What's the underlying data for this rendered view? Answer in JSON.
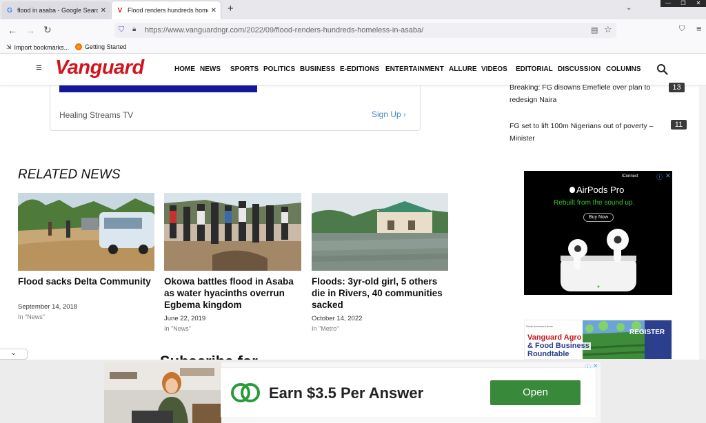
{
  "browser": {
    "tabs": [
      {
        "title": "flood in asaba - Google Search",
        "favicon": "G"
      },
      {
        "title": "Flood renders hundreds homeless in Asaba",
        "favicon": "V"
      }
    ],
    "url": "https://www.vanguardngr.com/2022/09/flood-renders-hundreds-homeless-in-asaba/",
    "bookmarks": [
      "Import bookmarks...",
      "Getting Started"
    ]
  },
  "site": {
    "logo": "Vanguard",
    "menu": [
      "HOME",
      "NEWS",
      "SPORTS",
      "POLITICS",
      "BUSINESS",
      "E-EDITIONS",
      "ENTERTAINMENT",
      "ALLURE",
      "VIDEOS",
      "EDITORIAL",
      "DISCUSSION",
      "COLUMNS"
    ]
  },
  "sponsor_card": {
    "name": "Healing Streams TV",
    "cta": "Sign Up"
  },
  "trending": [
    {
      "text": "Breaking: FG disowns Emefiele over plan to redesign Naira",
      "rank": "13"
    },
    {
      "text": "FG set to lift 100m Nigerians out of poverty – Minister",
      "rank": "11"
    }
  ],
  "related": {
    "heading": "RELATED NEWS",
    "items": [
      {
        "title": "Flood sacks Delta Community",
        "date": "September 14, 2018",
        "category": "In \"News\""
      },
      {
        "title": "Okowa battles flood in Asaba as water hyacinths overrun Egbema kingdom",
        "date": "June 22, 2019",
        "category": "In \"News\""
      },
      {
        "title": "Floods: 3yr-old girl, 5 others die in Rivers, 40 communities sacked",
        "date": "October 14, 2022",
        "category": "In \"Metro\""
      }
    ]
  },
  "subscribe_heading": "Subscribe for",
  "ads": {
    "airpods": {
      "brand": "AirPods Pro",
      "tagline": "Rebuilt from the sound up.",
      "cta": "Buy Now",
      "partner": "iConnect"
    },
    "agro": {
      "line1": "Vanguard Agro",
      "line2": "& Food Business",
      "line3": "Roundtable",
      "cta": "REGISTER",
      "tiny": "Scale document down"
    },
    "bottom": {
      "headline": "Earn $3.5 Per Answer",
      "cta": "Open"
    }
  },
  "colors": {
    "brand_red": "#d3141c",
    "link_blue": "#3d86c6",
    "open_green": "#39893a",
    "ad_green": "#34c72b"
  }
}
